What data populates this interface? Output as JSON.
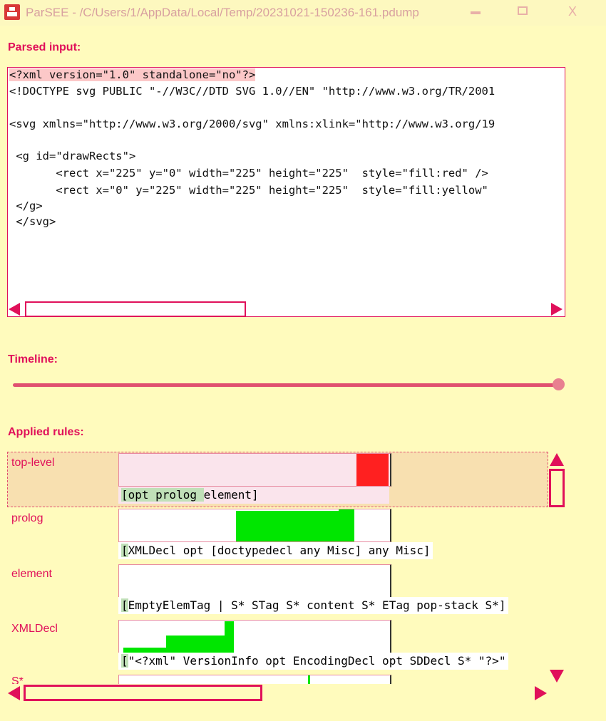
{
  "window": {
    "title": "ParSEE - /C/Users/1/AppData/Local/Temp/20231021-150236-161.pdump",
    "minimize": "▬",
    "maximize": "▢",
    "close": "X"
  },
  "parsed_input": {
    "label": "Parsed input:",
    "lines": [
      "<?xml version=\"1.0\" standalone=\"no\"?>",
      "<!DOCTYPE svg PUBLIC \"-//W3C//DTD SVG 1.0//EN\" \"http://www.w3.org/TR/2001",
      "",
      "<svg xmlns=\"http://www.w3.org/2000/svg\" xmlns:xlink=\"http://www.w3.org/19",
      "",
      " <g id=\"drawRects\">",
      "       <rect x=\"225\" y=\"0\" width=\"225\" height=\"225\"  style=\"fill:red\" />",
      "       <rect x=\"0\" y=\"225\" width=\"225\" height=\"225\"  style=\"fill:yellow\"",
      " </g>",
      " </svg>"
    ]
  },
  "timeline": {
    "label": "Timeline:",
    "value": 1.0
  },
  "applied_rules": {
    "label": "Applied rules:",
    "rules": [
      {
        "name": "top-level",
        "matched": "[opt prolog ",
        "rest": "element]"
      },
      {
        "name": "prolog",
        "matched": "[",
        "rest": "XMLDecl opt [doctypedecl any Misc] any Misc]"
      },
      {
        "name": "element",
        "matched": "[",
        "rest": "EmptyElemTag | S* STag S* content S* ETag pop-stack S*]"
      },
      {
        "name": "XMLDecl",
        "matched": "[",
        "rest": "\"<?xml\" VersionInfo opt EncodingDecl opt SDDecl S* \"?>\""
      },
      {
        "name": "S*",
        "matched": "",
        "rest": ""
      }
    ]
  },
  "colors": {
    "accent": "#e0105a",
    "background": "#fffbbd",
    "match": "#00e600",
    "fail": "#ff2020"
  }
}
